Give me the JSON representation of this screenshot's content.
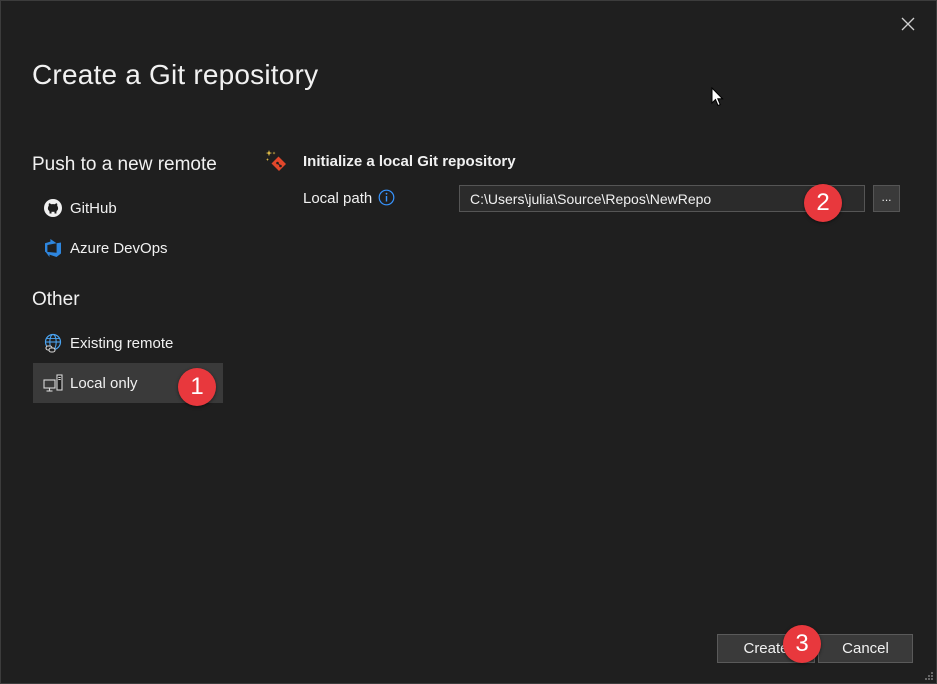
{
  "dialog": {
    "title": "Create a Git repository",
    "close_icon": "close-icon"
  },
  "sidebar": {
    "push_heading": "Push to a new remote",
    "push_items": [
      {
        "label": "GitHub",
        "icon": "github-icon"
      },
      {
        "label": "Azure DevOps",
        "icon": "azure-devops-icon"
      }
    ],
    "other_heading": "Other",
    "other_items": [
      {
        "label": "Existing remote",
        "icon": "globe-link-icon"
      },
      {
        "label": "Local only",
        "icon": "local-computer-icon",
        "selected": true
      }
    ]
  },
  "main": {
    "section_title": "Initialize a local Git repository",
    "section_icon": "git-init-icon",
    "local_path_label": "Local path",
    "local_path_value": "C:\\Users\\julia\\Source\\Repos\\NewRepo",
    "browse_label": "..."
  },
  "annotations": {
    "step1": "1",
    "step2": "2",
    "step3": "3"
  },
  "footer": {
    "create_label": "Create",
    "cancel_label": "Cancel"
  },
  "colors": {
    "background": "#1f1f1f",
    "selected": "#3a3a3a",
    "badge": "#e8383d",
    "info_blue": "#3794ff",
    "azure_blue": "#2e86de",
    "git_red": "#e2472b"
  }
}
